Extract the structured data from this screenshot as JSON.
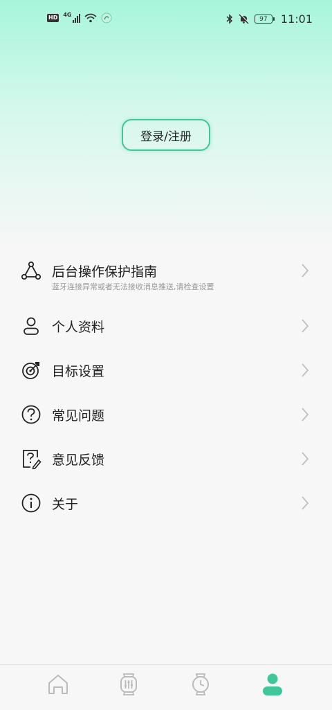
{
  "status_bar": {
    "hd_label": "HD",
    "network_label": "4G",
    "battery_level": "97",
    "time": "11:01"
  },
  "header": {
    "login_label": "登录/注册"
  },
  "menu": {
    "items": [
      {
        "label": "后台操作保护指南",
        "sub": "蓝牙连接异常或者无法接收消息推送,请检查设置",
        "icon": "network-nodes-icon"
      },
      {
        "label": "个人资料",
        "icon": "person-icon"
      },
      {
        "label": "目标设置",
        "icon": "target-icon"
      },
      {
        "label": "常见问题",
        "icon": "question-circle-icon"
      },
      {
        "label": "意见反馈",
        "icon": "feedback-icon"
      },
      {
        "label": "关于",
        "icon": "info-circle-icon"
      }
    ]
  },
  "bottom_nav": {
    "tabs": [
      {
        "icon": "home-icon",
        "active": false
      },
      {
        "icon": "watch-face-icon",
        "active": false
      },
      {
        "icon": "watch-icon",
        "active": false
      },
      {
        "icon": "profile-icon",
        "active": true
      }
    ]
  },
  "colors": {
    "accent": "#3fc79a",
    "gradient_top": "#a8f5dc",
    "background": "#f7f7f7"
  }
}
